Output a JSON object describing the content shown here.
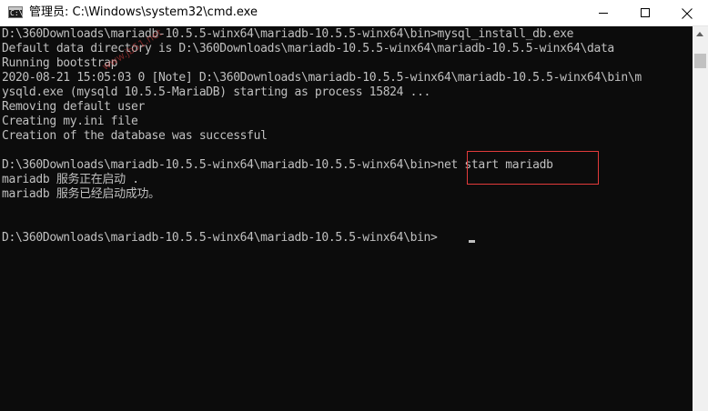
{
  "window": {
    "title": "管理员: C:\\Windows\\system32\\cmd.exe",
    "app_icon": "cmd-icon"
  },
  "titlebar_buttons": [
    {
      "name": "minimize",
      "icon": "minimize-icon"
    },
    {
      "name": "maximize",
      "icon": "maximize-icon"
    },
    {
      "name": "close",
      "icon": "close-icon"
    }
  ],
  "console": {
    "lines": [
      "D:\\360Downloads\\mariadb-10.5.5-winx64\\mariadb-10.5.5-winx64\\bin>mysql_install_db.exe",
      "Default data directory is D:\\360Downloads\\mariadb-10.5.5-winx64\\mariadb-10.5.5-winx64\\data",
      "Running bootstrap",
      "2020-08-21 15:05:03 0 [Note] D:\\360Downloads\\mariadb-10.5.5-winx64\\mariadb-10.5.5-winx64\\bin\\m",
      "ysqld.exe (mysqld 10.5.5-MariaDB) starting as process 15824 ...",
      "Removing default user",
      "Creating my.ini file",
      "Creation of the database was successful",
      "",
      "D:\\360Downloads\\mariadb-10.5.5-winx64\\mariadb-10.5.5-winx64\\bin>net start mariadb",
      "mariadb 服务正在启动 .",
      "mariadb 服务已经启动成功。",
      "",
      "",
      "D:\\360Downloads\\mariadb-10.5.5-winx64\\mariadb-10.5.5-winx64\\bin>"
    ],
    "highlighted_command": "net start mariadb",
    "text_color": "#c0c0c0",
    "background_color": "#0c0c0c",
    "highlight_color": "#e23b3b"
  },
  "watermark": "www.jb51.net"
}
